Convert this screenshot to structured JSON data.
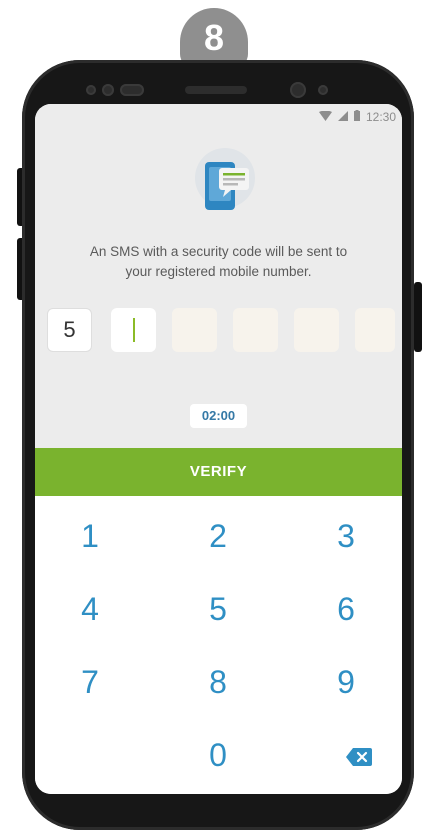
{
  "step_number": "8",
  "status_bar": {
    "time": "12:30",
    "wifi_icon": "wifi-icon",
    "signal_icon": "signal-icon",
    "battery_icon": "battery-icon"
  },
  "illustration": {
    "icon": "sms-phone-icon",
    "accent": "#2e86c1"
  },
  "message": "An SMS with a security code will be sent to\nyour registered mobile number.",
  "code_digits": [
    "5",
    "",
    "",
    "",
    "",
    ""
  ],
  "timer": "02:00",
  "verify_button": {
    "label": "VERIFY",
    "color": "#7ab32e"
  },
  "keypad": {
    "keys": [
      "1",
      "2",
      "3",
      "4",
      "5",
      "6",
      "7",
      "8",
      "9",
      "0"
    ],
    "backspace_icon": "backspace-icon",
    "key_color": "#2f8fc4"
  }
}
